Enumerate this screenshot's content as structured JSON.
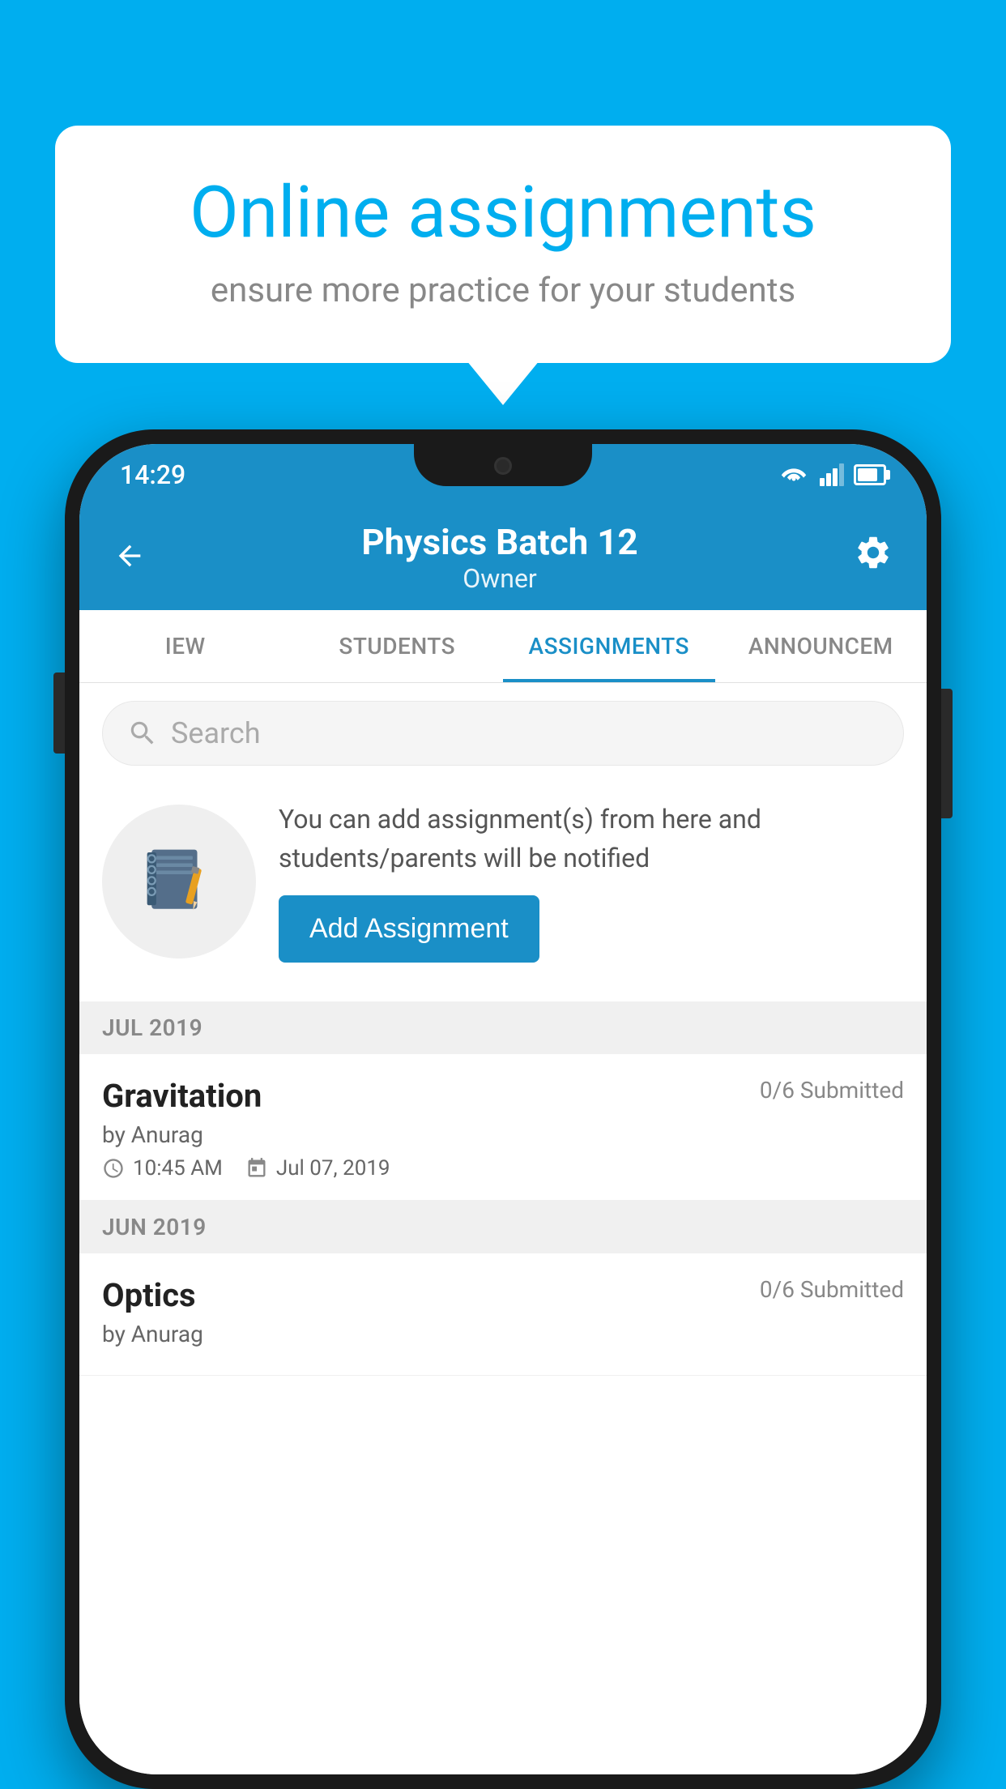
{
  "background": {
    "color": "#00AEEF"
  },
  "speech_bubble": {
    "title": "Online assignments",
    "subtitle": "ensure more practice for your students"
  },
  "status_bar": {
    "time": "14:29"
  },
  "app_bar": {
    "title": "Physics Batch 12",
    "subtitle": "Owner",
    "back_label": "←"
  },
  "tabs": [
    {
      "label": "IEW",
      "active": false
    },
    {
      "label": "STUDENTS",
      "active": false
    },
    {
      "label": "ASSIGNMENTS",
      "active": true
    },
    {
      "label": "ANNOUNCEM",
      "active": false
    }
  ],
  "search": {
    "placeholder": "Search"
  },
  "promo": {
    "description": "You can add assignment(s) from here and students/parents will be notified",
    "button_label": "Add Assignment"
  },
  "sections": [
    {
      "header": "JUL 2019",
      "assignments": [
        {
          "name": "Gravitation",
          "submitted": "0/6 Submitted",
          "by": "by Anurag",
          "time": "10:45 AM",
          "date": "Jul 07, 2019"
        }
      ]
    },
    {
      "header": "JUN 2019",
      "assignments": [
        {
          "name": "Optics",
          "submitted": "0/6 Submitted",
          "by": "by Anurag",
          "time": "",
          "date": ""
        }
      ]
    }
  ]
}
